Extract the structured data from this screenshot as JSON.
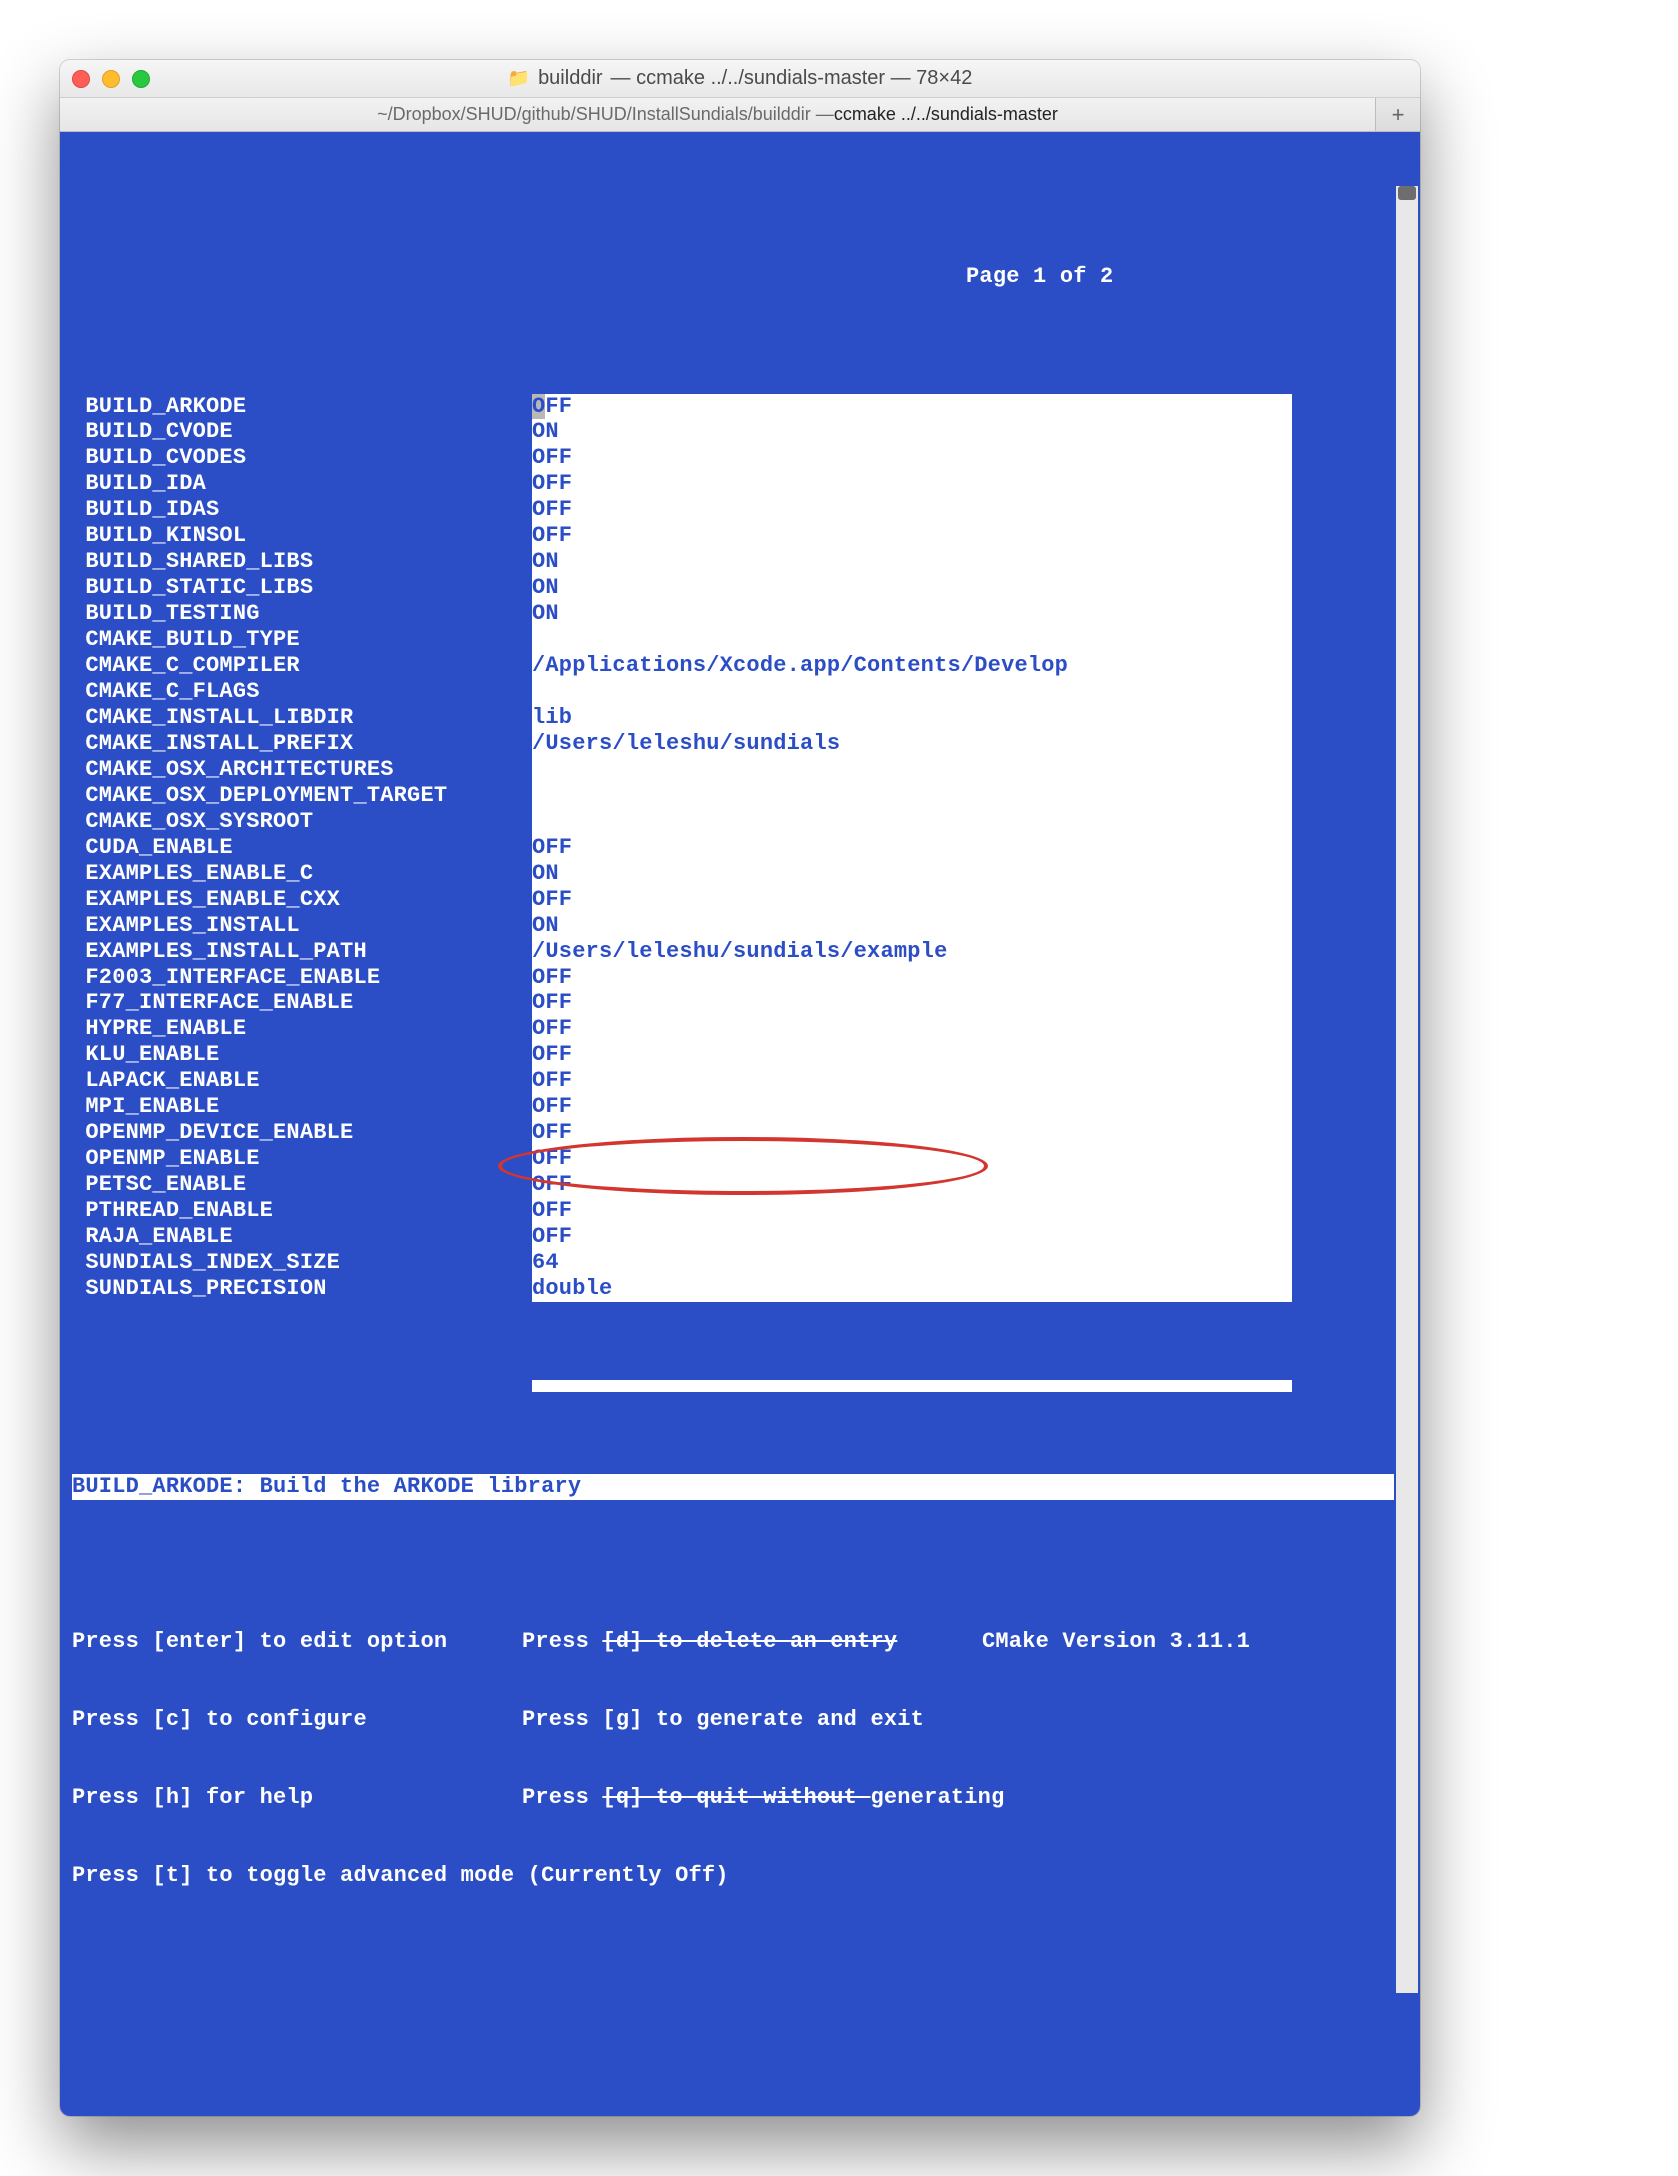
{
  "window": {
    "title_folder": "builddir",
    "title_rest": " — ccmake ../../sundials-master — 78×42"
  },
  "tab": {
    "path": "~/Dropbox/SHUD/github/SHUD/InstallSundials/builddir — ",
    "cmd": "ccmake ../../sundials-master"
  },
  "page_indicator": "Page 1 of 2",
  "entries": [
    {
      "name": "BUILD_ARKODE",
      "value": "OFF",
      "cursor_first": true
    },
    {
      "name": "BUILD_CVODE",
      "value": "ON"
    },
    {
      "name": "BUILD_CVODES",
      "value": "OFF"
    },
    {
      "name": "BUILD_IDA",
      "value": "OFF"
    },
    {
      "name": "BUILD_IDAS",
      "value": "OFF"
    },
    {
      "name": "BUILD_KINSOL",
      "value": "OFF"
    },
    {
      "name": "BUILD_SHARED_LIBS",
      "value": "ON"
    },
    {
      "name": "BUILD_STATIC_LIBS",
      "value": "ON"
    },
    {
      "name": "BUILD_TESTING",
      "value": "ON"
    },
    {
      "name": "CMAKE_BUILD_TYPE",
      "value": ""
    },
    {
      "name": "CMAKE_C_COMPILER",
      "value": "/Applications/Xcode.app/Contents/Develop"
    },
    {
      "name": "CMAKE_C_FLAGS",
      "value": ""
    },
    {
      "name": "CMAKE_INSTALL_LIBDIR",
      "value": "lib"
    },
    {
      "name": "CMAKE_INSTALL_PREFIX",
      "value": "/Users/leleshu/sundials"
    },
    {
      "name": "CMAKE_OSX_ARCHITECTURES",
      "value": ""
    },
    {
      "name": "CMAKE_OSX_DEPLOYMENT_TARGET",
      "value": ""
    },
    {
      "name": "CMAKE_OSX_SYSROOT",
      "value": ""
    },
    {
      "name": "CUDA_ENABLE",
      "value": "OFF"
    },
    {
      "name": "EXAMPLES_ENABLE_C",
      "value": "ON"
    },
    {
      "name": "EXAMPLES_ENABLE_CXX",
      "value": "OFF"
    },
    {
      "name": "EXAMPLES_INSTALL",
      "value": "ON"
    },
    {
      "name": "EXAMPLES_INSTALL_PATH",
      "value": "/Users/leleshu/sundials/example"
    },
    {
      "name": "F2003_INTERFACE_ENABLE",
      "value": "OFF"
    },
    {
      "name": "F77_INTERFACE_ENABLE",
      "value": "OFF"
    },
    {
      "name": "HYPRE_ENABLE",
      "value": "OFF"
    },
    {
      "name": "KLU_ENABLE",
      "value": "OFF"
    },
    {
      "name": "LAPACK_ENABLE",
      "value": "OFF"
    },
    {
      "name": "MPI_ENABLE",
      "value": "OFF"
    },
    {
      "name": "OPENMP_DEVICE_ENABLE",
      "value": "OFF"
    },
    {
      "name": "OPENMP_ENABLE",
      "value": "OFF"
    },
    {
      "name": "PETSC_ENABLE",
      "value": "OFF"
    },
    {
      "name": "PTHREAD_ENABLE",
      "value": "OFF"
    },
    {
      "name": "RAJA_ENABLE",
      "value": "OFF"
    },
    {
      "name": "SUNDIALS_INDEX_SIZE",
      "value": "64"
    },
    {
      "name": "SUNDIALS_PRECISION",
      "value": "double"
    }
  ],
  "help_line": "BUILD_ARKODE: Build the ARKODE library",
  "status": {
    "r1c1": "Press [enter] to edit option",
    "r1c2a": "Press ",
    "r1c2b": "[d] to delete an entry",
    "r1c3": "CMake Version 3.11.1",
    "r2c1": "Press [c] to configure",
    "r2c2": "Press [g] to generate and exit",
    "r3c1": "Press [h] for help",
    "r3c2a": "Press ",
    "r3c2b": "[q] to quit without ",
    "r3c2c": "generating",
    "r4": "Press [t] to toggle advanced mode (Currently Off)"
  }
}
